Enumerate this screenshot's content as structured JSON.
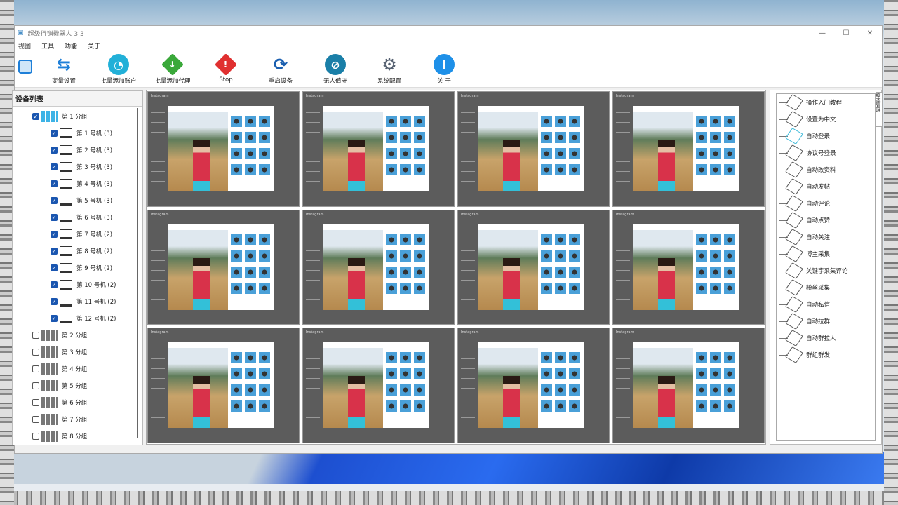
{
  "window": {
    "title": "超级行销機器人 3.3",
    "controls": [
      "—",
      "☐",
      "✕"
    ]
  },
  "menu": [
    "视图",
    "工具",
    "功能",
    "关于"
  ],
  "toolbar": [
    {
      "label": "变量设置",
      "icon": "flow-icon",
      "color": "#1e7fd8"
    },
    {
      "label": "批量添加账户",
      "icon": "ring-icon",
      "color": "#22b0d8"
    },
    {
      "label": "批量添加代理",
      "icon": "download-diamond-icon",
      "color": "#3aa83a"
    },
    {
      "label": "Stop",
      "icon": "stop-warning-icon",
      "color": "#e03030"
    },
    {
      "label": "重启设备",
      "icon": "restart-icon",
      "color": "#1a5fb0"
    },
    {
      "label": "无人值守",
      "icon": "unattended-icon",
      "color": "#1a7fa8"
    },
    {
      "label": "系统配置",
      "icon": "gear-icon",
      "color": "#556070"
    },
    {
      "label": "关 于",
      "icon": "info-icon",
      "color": "#1e90e8"
    }
  ],
  "device_panel": {
    "title": "设备列表",
    "groups": [
      {
        "label": "第 1 分组",
        "checked": true,
        "devices": [
          {
            "label": "第 1 号机 (3)"
          },
          {
            "label": "第 2 号机 (3)"
          },
          {
            "label": "第 3 号机 (3)"
          },
          {
            "label": "第 4 号机 (3)"
          },
          {
            "label": "第 5 号机 (3)"
          },
          {
            "label": "第 6 号机 (3)"
          },
          {
            "label": "第 7 号机 (2)"
          },
          {
            "label": "第 8 号机 (2)"
          },
          {
            "label": "第 9 号机 (2)"
          },
          {
            "label": "第 10 号机 (2)"
          },
          {
            "label": "第 11 号机 (2)"
          },
          {
            "label": "第 12 号机 (2)"
          }
        ]
      },
      {
        "label": "第 2 分组",
        "checked": false
      },
      {
        "label": "第 3 分组",
        "checked": false
      },
      {
        "label": "第 4 分组",
        "checked": false
      },
      {
        "label": "第 5 分组",
        "checked": false
      },
      {
        "label": "第 6 分组",
        "checked": false
      },
      {
        "label": "第 7 分组",
        "checked": false
      },
      {
        "label": "第 8 分组",
        "checked": false
      }
    ]
  },
  "screens": {
    "count": 12,
    "app_name": "Instagram"
  },
  "script_panel": {
    "tab": "脚本管理",
    "items": [
      "操作入门教程",
      "设置为中文",
      "自动登录",
      "协议号登录",
      "自动改资料",
      "自动发帖",
      "自动评论",
      "自动点赞",
      "自动关注",
      "博主采集",
      "关键字采集评论",
      "粉丝采集",
      "自动私信",
      "自动拉群",
      "自动群拉人",
      "群组群发"
    ],
    "active": 2
  }
}
